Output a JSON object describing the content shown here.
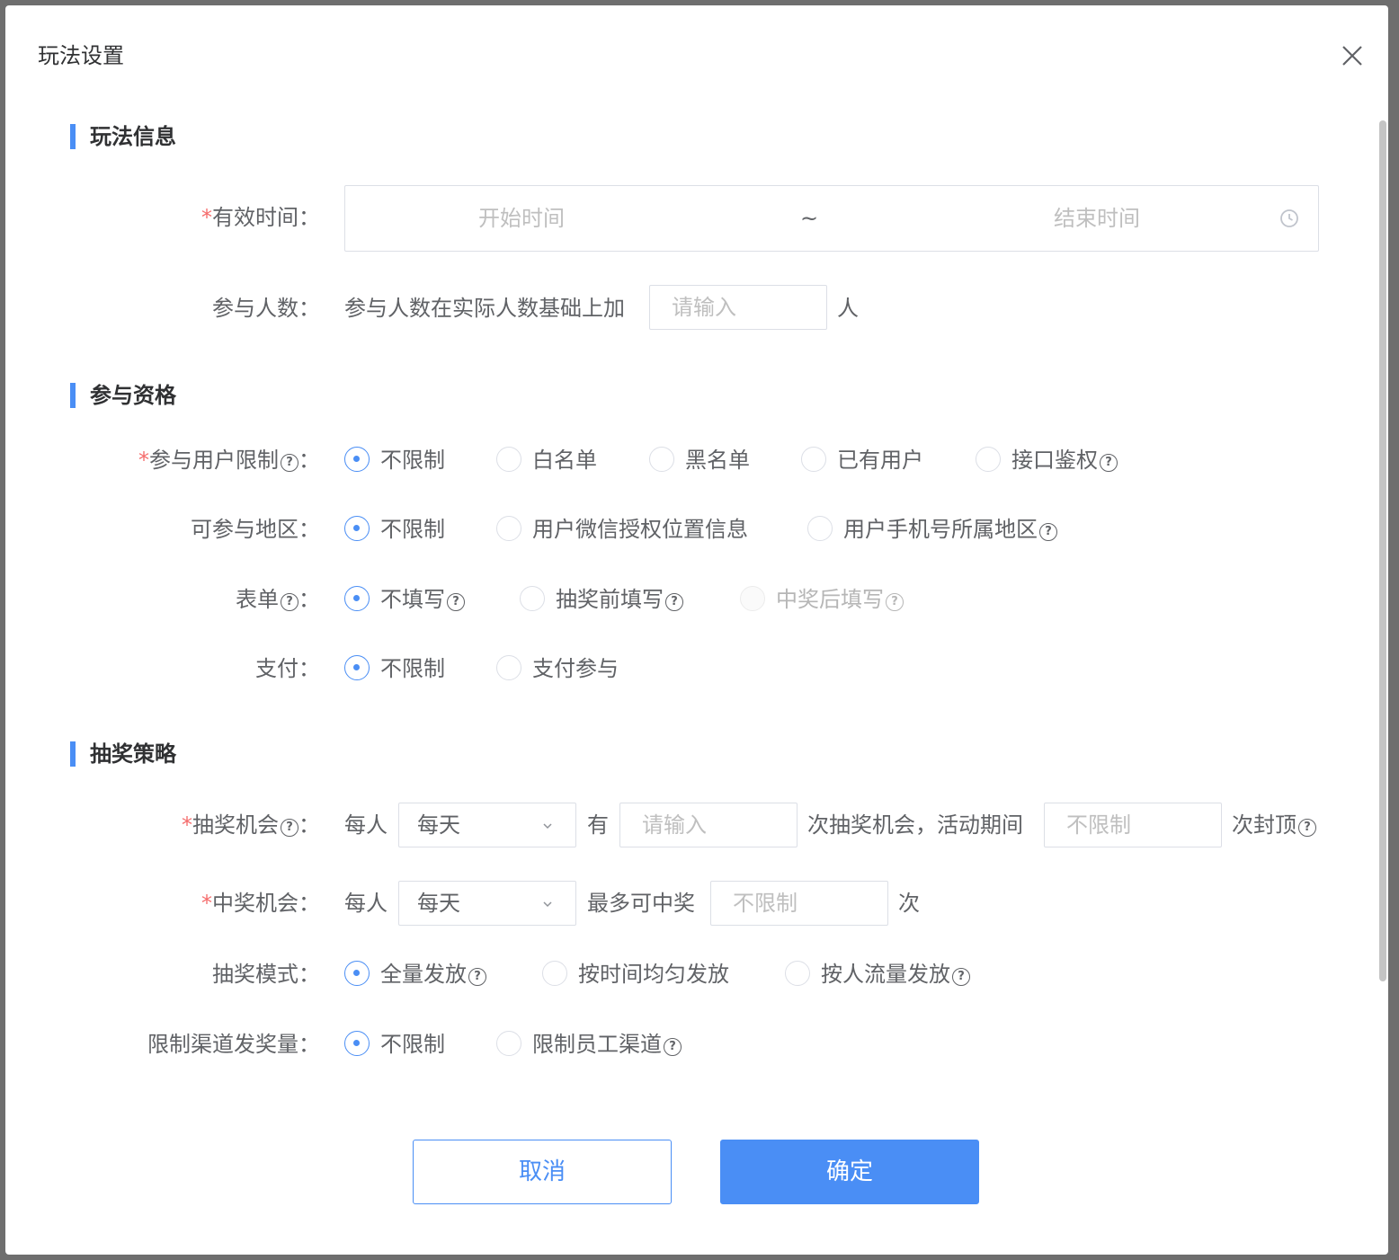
{
  "dialog": {
    "title": "玩法设置"
  },
  "sections": {
    "info": "玩法信息",
    "eligibility": "参与资格",
    "strategy": "抽奖策略"
  },
  "valid_time": {
    "label": "有效时间：",
    "start_placeholder": "开始时间",
    "separator": "~",
    "end_placeholder": "结束时间"
  },
  "participants": {
    "label": "参与人数：",
    "prefix": "参与人数在实际人数基础上加",
    "placeholder": "请输入",
    "suffix": "人"
  },
  "user_limit": {
    "label": "参与用户限制",
    "colon": "：",
    "options": [
      "不限制",
      "白名单",
      "黑名单",
      "已有用户",
      "接口鉴权"
    ],
    "selected": "不限制"
  },
  "region": {
    "label": "可参与地区：",
    "options": [
      "不限制",
      "用户微信授权位置信息",
      "用户手机号所属地区"
    ],
    "selected": "不限制"
  },
  "form": {
    "label": "表单",
    "colon": "：",
    "options": [
      "不填写",
      "抽奖前填写",
      "中奖后填写"
    ],
    "selected": "不填写"
  },
  "payment": {
    "label": "支付：",
    "options": [
      "不限制",
      "支付参与"
    ],
    "selected": "不限制"
  },
  "draw_chance": {
    "label": "抽奖机会",
    "colon": "：",
    "per_person": "每人",
    "period": "每天",
    "has": "有",
    "count_placeholder": "请输入",
    "mid_text": "次抽奖机会，活动期间",
    "cap_placeholder": "不限制",
    "suffix": "次封顶"
  },
  "win_chance": {
    "label": "中奖机会：",
    "per_person": "每人",
    "period": "每天",
    "max_text": "最多可中奖",
    "placeholder": "不限制",
    "suffix": "次"
  },
  "draw_mode": {
    "label": "抽奖模式：",
    "options": [
      "全量发放",
      "按时间均匀发放",
      "按人流量发放"
    ],
    "selected": "全量发放"
  },
  "channel_limit": {
    "label": "限制渠道发奖量：",
    "options": [
      "不限制",
      "限制员工渠道"
    ],
    "selected": "不限制"
  },
  "buttons": {
    "cancel": "取消",
    "confirm": "确定"
  },
  "icons": {
    "close": "close-icon",
    "help": "question-circle-icon",
    "clock": "clock-icon",
    "chevron": "chevron-down-icon"
  },
  "colors": {
    "primary": "#4a8ef5",
    "required": "#f56c6c"
  },
  "help_glyph": "?"
}
